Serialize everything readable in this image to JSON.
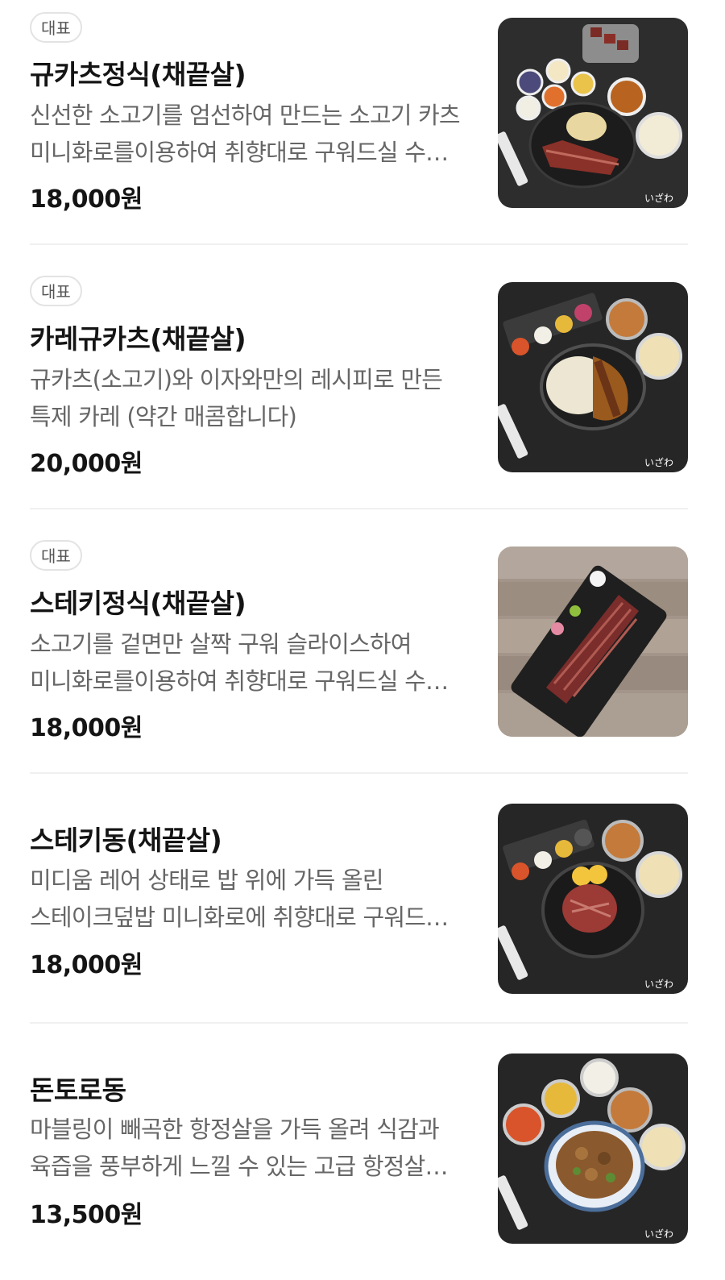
{
  "menu": {
    "items": [
      {
        "badge": "대표",
        "title": "규카츠정식(채끝살)",
        "description": "신선한 소고기를 엄선하여 만드는 소고기 카츠 미니화로를이용하여 취향대로 구워드실 수 있습니다",
        "price": "18,000원",
        "image_alt": "gyukatsu-set-photo",
        "watermark": "いざわ"
      },
      {
        "badge": "대표",
        "title": "카레규카츠(채끝살)",
        "description": "규카츠(소고기)와 이자와만의 레시피로 만든 특제 카레 (약간 매콤합니다)",
        "price": "20,000원",
        "image_alt": "curry-gyukatsu-photo",
        "watermark": "いざわ"
      },
      {
        "badge": "대표",
        "title": "스테키정식(채끝살)",
        "description": "소고기를 겉면만 살짝 구워 슬라이스하여 미니화로를이용하여 취향대로 구워드실 수 있습니다",
        "price": "18,000원",
        "image_alt": "steak-set-photo"
      },
      {
        "title": "스테키동(채끝살)",
        "description": "미디움 레어 상태로 밥 위에 가득 올린 스테이크덮밥 미니화로에 취향대로 구워드실 수 있습니다",
        "price": "18,000원",
        "image_alt": "steak-don-photo",
        "watermark": "いざわ"
      },
      {
        "title": "돈토로동",
        "description": "마블링이 빼곡한 항정살을 가득 올려 식감과 육즙을 풍부하게 느낄 수 있는 고급 항정살 덮밥",
        "price": "13,500원",
        "image_alt": "dontoro-don-photo",
        "watermark": "いざわ"
      }
    ]
  },
  "colors": {
    "text_primary": "#141414",
    "text_secondary": "#666666",
    "badge_border": "#e3e3e3",
    "divider": "#f0f0f0",
    "photo_background": "#2a2a2a"
  }
}
